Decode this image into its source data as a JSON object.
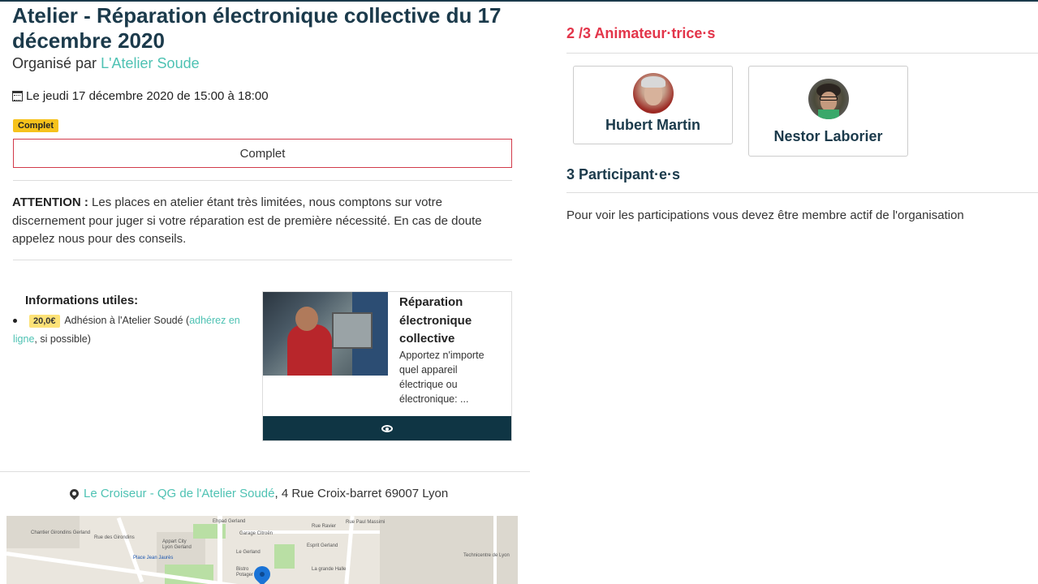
{
  "event": {
    "title": "Atelier - Réparation électronique collective du 17 décembre 2020",
    "organized_prefix": "Organisé par",
    "organizer_name": "L'Atelier Soude",
    "date_text": "Le jeudi 17 décembre 2020 de 15:00 à 18:00",
    "status_badge": "Complet",
    "status_button": "Complet",
    "attention_label": "ATTENTION :",
    "attention_text": " Les places en atelier étant très limitées, nous comptons sur votre discernement pour juger si votre réparation est de première nécessité. En cas de doute appelez nous pour des conseils."
  },
  "info": {
    "title": "Informations utiles:",
    "price": "20,0€",
    "text_before": "Adhésion à l'Atelier Soudé (",
    "link": "adhérez en ligne",
    "text_after": ", si possible)"
  },
  "card": {
    "title": "Réparation électronique collective",
    "description": "Apportez n'importe quel appareil électrique ou électronique: ...",
    "view_icon": "eye-icon"
  },
  "location": {
    "place_link": "Le Croiseur - QG de l'Atelier Soudé",
    "address": ", 4 Rue Croix-barret 69007 Lyon",
    "icon": "map-marker-icon"
  },
  "map": {
    "labels": [
      "Chantier Girondins Gerland",
      "Rue des Girondins",
      "Place Jean Jaurès",
      "Appart City Lyon Gerland",
      "Ehpad Gerland",
      "Garage Citroën",
      "Le Gerland",
      "Bistro Potager",
      "Rue Ravier",
      "Rue Paul Massimi",
      "Esprit Gerland",
      "La grande Halle",
      "Technicentre de Lyon"
    ]
  },
  "animators": {
    "title": "2 /3 Animateur·trice·s",
    "people": [
      {
        "name": "Hubert Martin"
      },
      {
        "name": "Nestor Laborier"
      }
    ]
  },
  "participants": {
    "title": "3 Participant·e·s",
    "text": "Pour voir les participations vous devez être membre actif de l'organisation"
  },
  "colors": {
    "primary": "#1b3a4b",
    "accent": "#4ec2b3",
    "danger": "#e3354a",
    "badge": "#f6c21c"
  }
}
